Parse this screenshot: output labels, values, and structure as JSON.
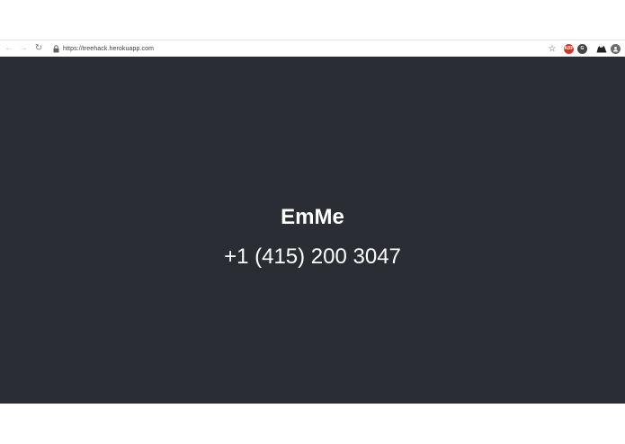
{
  "browser": {
    "url": "https://treehack.herokuapp.com",
    "icons": {
      "back": "arrow-left-icon",
      "forward": "arrow-right-icon",
      "reload": "reload-icon",
      "lock": "lock-icon",
      "bookmark": "star-icon"
    },
    "extensions": [
      {
        "name": "extension-red-icon",
        "label": "ABP"
      },
      {
        "name": "extension-dark-icon",
        "label": "G"
      },
      {
        "name": "extension-cat-icon",
        "label": ""
      },
      {
        "name": "profile-icon",
        "label": ""
      }
    ]
  },
  "page": {
    "title": "EmMe",
    "phone": "+1 (415) 200 3047",
    "background_color": "#2a2d33",
    "text_color": "#ffffff"
  }
}
